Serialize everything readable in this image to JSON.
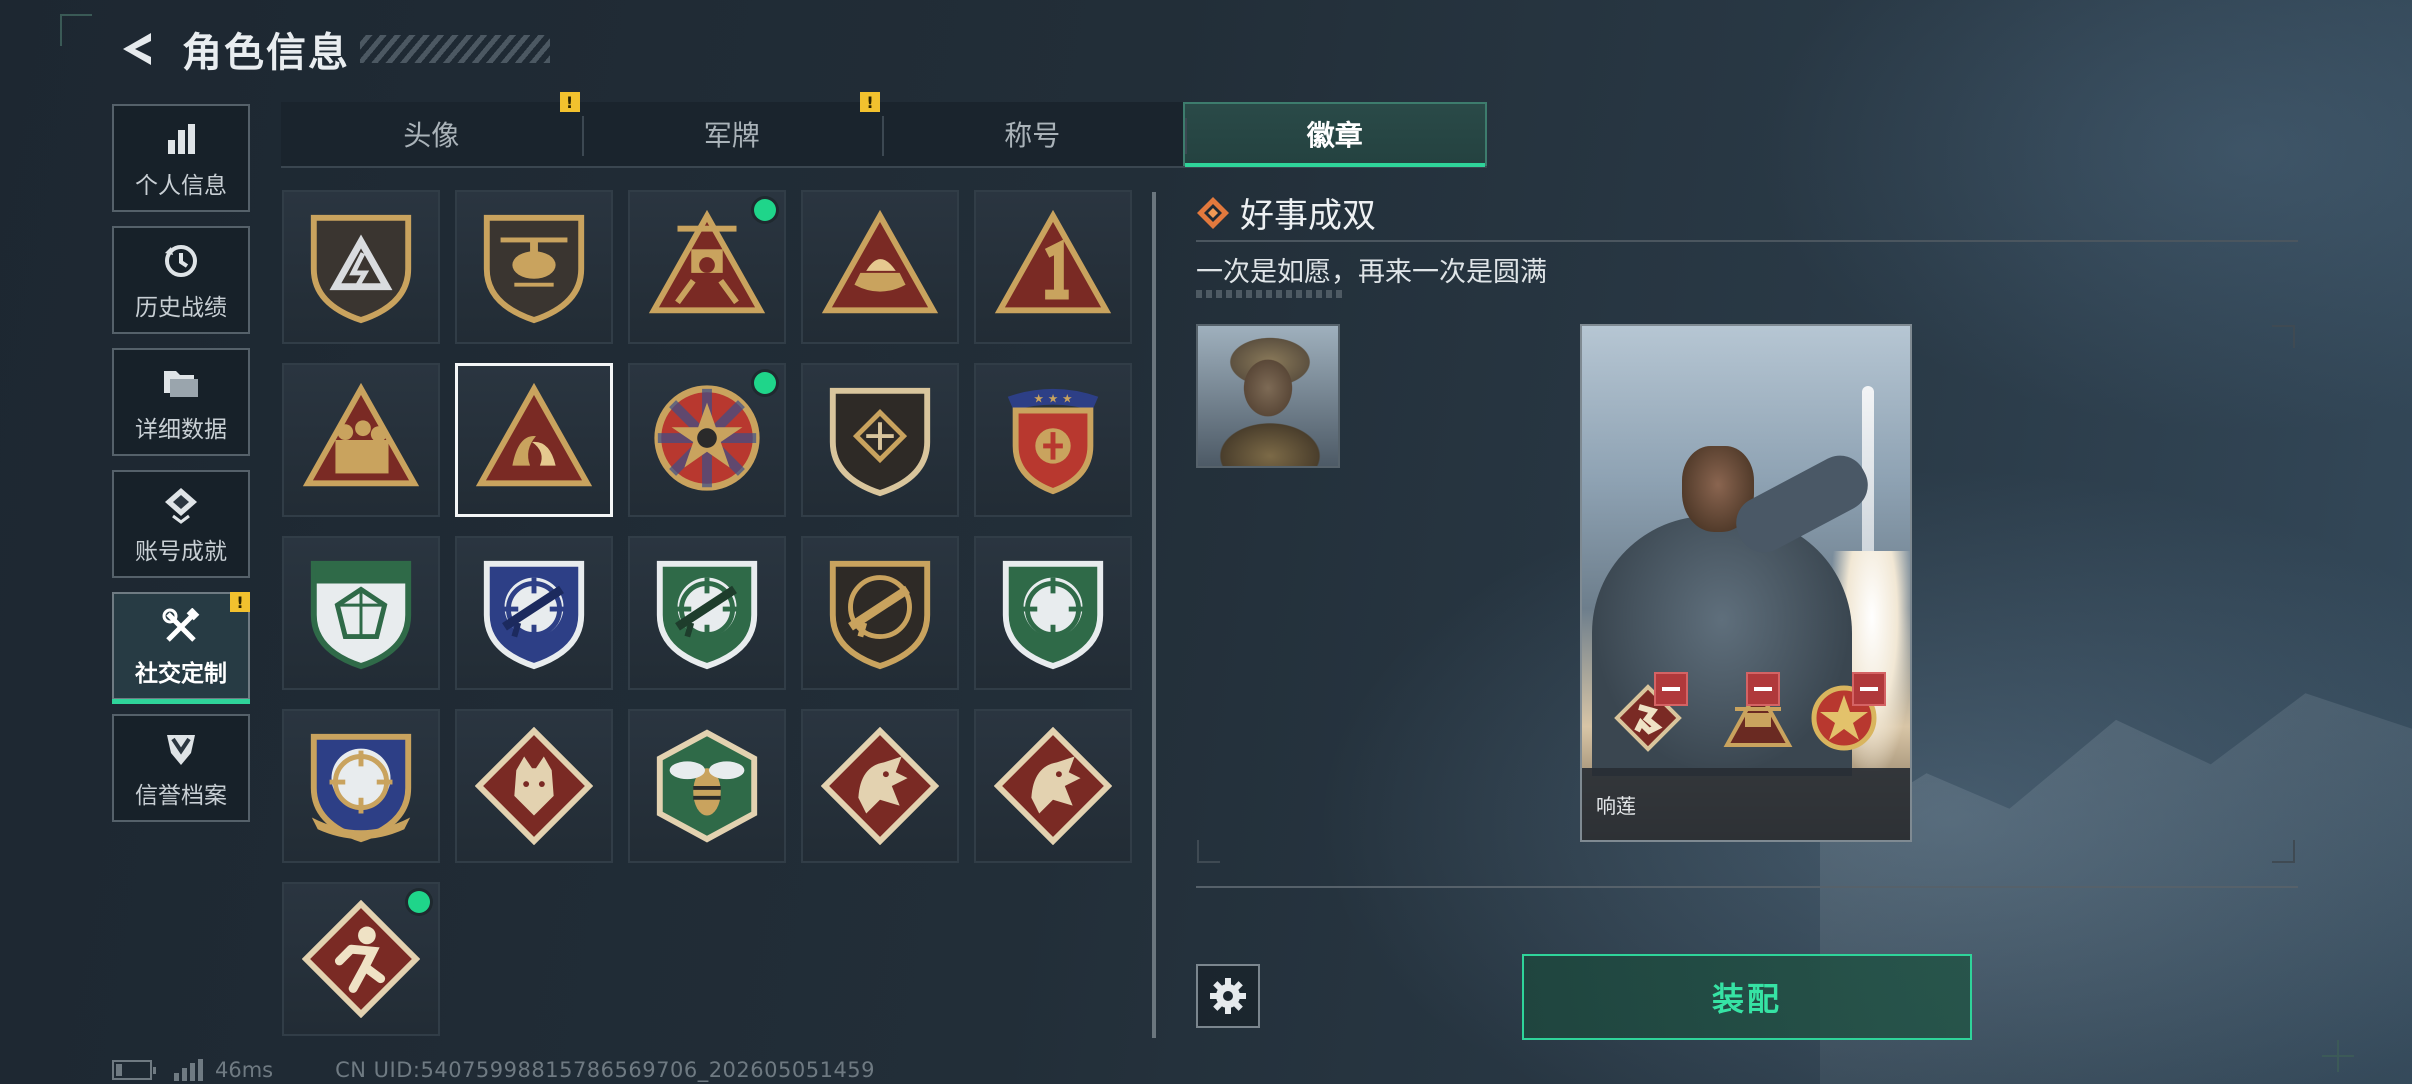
{
  "header": {
    "title": "角色信息"
  },
  "nav": {
    "items": [
      {
        "label": "个人信息",
        "icon": "bar-chart-icon",
        "active": false,
        "warning": false
      },
      {
        "label": "历史战绩",
        "icon": "history-icon",
        "active": false,
        "warning": false
      },
      {
        "label": "详细数据",
        "icon": "folder-icon",
        "active": false,
        "warning": false
      },
      {
        "label": "账号成就",
        "icon": "achievement-icon",
        "active": false,
        "warning": false
      },
      {
        "label": "社交定制",
        "icon": "tools-icon",
        "active": true,
        "warning": true
      },
      {
        "label": "信誉档案",
        "icon": "credit-shield-icon",
        "active": false,
        "warning": false
      }
    ]
  },
  "tabs": [
    {
      "label": "头像",
      "active": false,
      "warning": true
    },
    {
      "label": "军牌",
      "active": false,
      "warning": true
    },
    {
      "label": "称号",
      "active": false,
      "warning": false
    },
    {
      "label": "徽章",
      "active": true,
      "warning": false
    }
  ],
  "badges": [
    {
      "icon": "lightning-shield-badge",
      "new": false,
      "selected": false
    },
    {
      "icon": "helicopter-shield-badge",
      "new": false,
      "selected": false
    },
    {
      "icon": "chopper-triangle-badge",
      "new": true,
      "selected": false
    },
    {
      "icon": "boat-triangle-badge",
      "new": false,
      "selected": false
    },
    {
      "icon": "number-one-triangle-badge",
      "new": false,
      "selected": false
    },
    {
      "icon": "soldiers-triangle-badge",
      "new": false,
      "selected": false
    },
    {
      "icon": "twin-fish-triangle-badge",
      "new": false,
      "selected": true
    },
    {
      "icon": "star-circle-badge",
      "new": true,
      "selected": false
    },
    {
      "icon": "wing-shield-badge",
      "new": false,
      "selected": false
    },
    {
      "icon": "star-ribbon-shield-badge",
      "new": false,
      "selected": false
    },
    {
      "icon": "gem-green-shield-badge",
      "new": false,
      "selected": false
    },
    {
      "icon": "sniper-blue-shield-badge",
      "new": false,
      "selected": false
    },
    {
      "icon": "rifle-green-shield-badge",
      "new": false,
      "selected": false
    },
    {
      "icon": "rifle-dark-shield-badge",
      "new": false,
      "selected": false
    },
    {
      "icon": "crosshair-green-shield-badge",
      "new": false,
      "selected": false
    },
    {
      "icon": "crosshair-gold-shield-badge",
      "new": false,
      "selected": false
    },
    {
      "icon": "wolf-diamond-badge",
      "new": false,
      "selected": false
    },
    {
      "icon": "hornet-hexagon-badge",
      "new": false,
      "selected": false
    },
    {
      "icon": "dragon-diamond-badge",
      "new": false,
      "selected": false
    },
    {
      "icon": "dragon-diamond-badge-2",
      "new": false,
      "selected": false
    },
    {
      "icon": "runner-diamond-badge",
      "new": true,
      "selected": false
    }
  ],
  "detail": {
    "name": "好事成双",
    "description": "一次是如愿，再来一次是圆满",
    "card_name": "响莲",
    "equip_label": "装配"
  },
  "status": {
    "ping": "46ms",
    "uid": "CN UID:5407599881578656970​6_202605051459"
  },
  "colors": {
    "accent": "#2fd49a",
    "warning": "#f2c12e",
    "new_dot": "#1fd58a",
    "badge_gold": "#c9a35e",
    "badge_red": "#7a2a24",
    "badge_green": "#2f6a48"
  }
}
